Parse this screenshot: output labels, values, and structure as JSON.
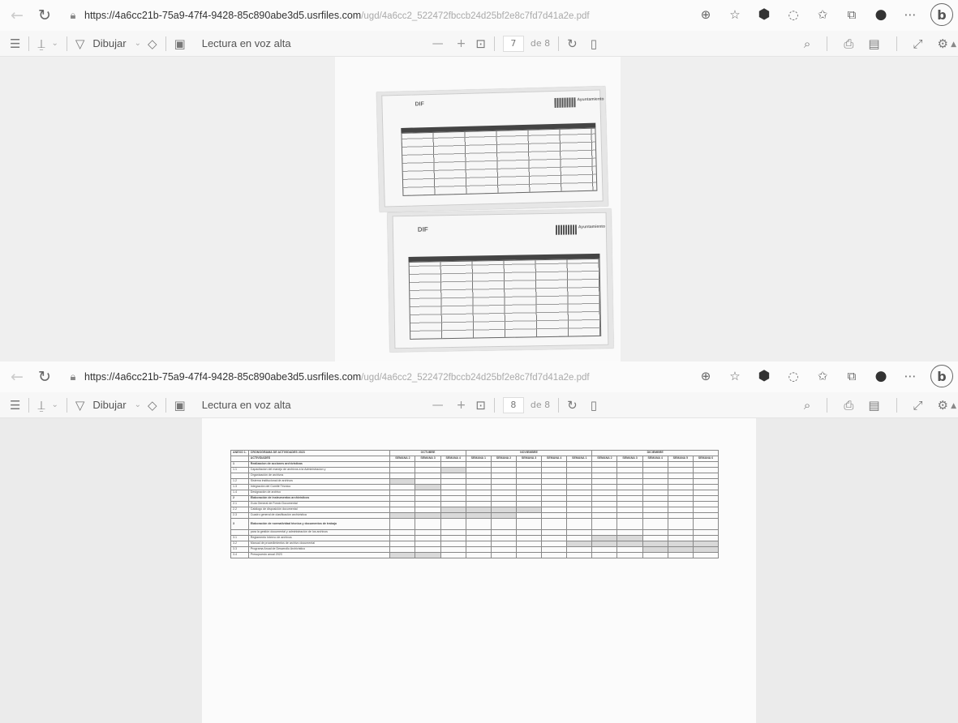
{
  "captures": [
    {
      "addressbar": {
        "url_host": "https://4a6cc21b-75a9-47f4-9428-85c890abe3d5.usrfiles.com",
        "url_path": "/ugd/4a6cc2_522472fbccb24d25bf2e8c7fd7d41a2e.pdf"
      },
      "pdfbar": {
        "draw_label": "Dibujar",
        "read_aloud_label": "Lectura en voz alta",
        "zoom_out": "—",
        "zoom_in": "+",
        "page_current": "7",
        "page_of": "de 8"
      }
    },
    {
      "addressbar": {
        "url_host": "https://4a6cc21b-75a9-47f4-9428-85c890abe3d5.usrfiles.com",
        "url_path": "/ugd/4a6cc2_522472fbccb24d25bf2e8c7fd7d41a2e.pdf"
      },
      "pdfbar": {
        "draw_label": "Dibujar",
        "read_aloud_label": "Lectura en voz alta",
        "zoom_out": "—",
        "zoom_in": "+",
        "page_current": "8",
        "page_of": "de 8"
      }
    }
  ],
  "page7": {
    "photo1_logo": "DIF",
    "photo2_logo": "DIF",
    "badge": "Ayuntamiento"
  },
  "schedule": {
    "annex": "ANEXO 1.",
    "title": "CRONOGRAMA DE ACTIVIDADES 2023",
    "activities_header": "ACTIVIDADES",
    "months": [
      "OCTUBRE",
      "NOVIEMBRE",
      "DICIEMBRE"
    ],
    "weeks": [
      "SEMANA 2",
      "SEMANA 3",
      "SEMANA 4",
      "SEMANA 1",
      "SEMANA 2",
      "SEMANA 3",
      "SEMANA 4",
      "SEMANA 1",
      "SEMANA 2",
      "SEMANA 3",
      "SEMANA 4",
      "SEMANA 5",
      "SEMANA 6"
    ],
    "rows": [
      {
        "num": "1",
        "text": "Realizacion de acciones archivisticas",
        "section": true,
        "filled": []
      },
      {
        "num": "1.1",
        "text": "Capacitacion del manejo de archivos a la Administracion y",
        "filled": [
          2
        ]
      },
      {
        "num": "",
        "text": "Organización de archivos",
        "filled": []
      },
      {
        "num": "1.2",
        "text": "Sistema institucional de archivos",
        "filled": [
          0
        ]
      },
      {
        "num": "1.3",
        "text": "Integración del Comité Técnico",
        "filled": [
          1
        ]
      },
      {
        "num": "1.4",
        "text": "Designación de archivo",
        "filled": []
      },
      {
        "num": "2",
        "text": "Elaboración de instrumentos archivísticos",
        "section": true,
        "filled": []
      },
      {
        "num": "2.1",
        "text": "Guía General de Fondo Documental",
        "filled": []
      },
      {
        "num": "2.2",
        "text": "Catálogo de disposición documental",
        "filled": [
          2,
          3,
          4,
          5
        ]
      },
      {
        "num": "2.3",
        "text": "Cuadro general de clasificación archivística",
        "filled": [
          0,
          1,
          2,
          3,
          4
        ]
      },
      {
        "num": "3",
        "text": "Elaboración de normatividad técnica y documentos de trabajo",
        "section": true,
        "tall": true,
        "filled": []
      },
      {
        "num": "",
        "text": "para la gestión documental y administración de los archivos",
        "filled": []
      },
      {
        "num": "3.1",
        "text": "Reglamento Interno de archivos",
        "filled": [
          8,
          9
        ]
      },
      {
        "num": "3.2",
        "text": "Manual de procedimientos de archivo documental",
        "filled": [
          7,
          8,
          9,
          10,
          11,
          12
        ]
      },
      {
        "num": "3.3",
        "text": "Programa Anual de Desarrollo Archivístico",
        "filled": [
          10,
          11,
          12
        ]
      },
      {
        "num": "3.4",
        "text": "Presupuesto anual 2023",
        "filled": [
          0,
          1
        ]
      }
    ]
  }
}
